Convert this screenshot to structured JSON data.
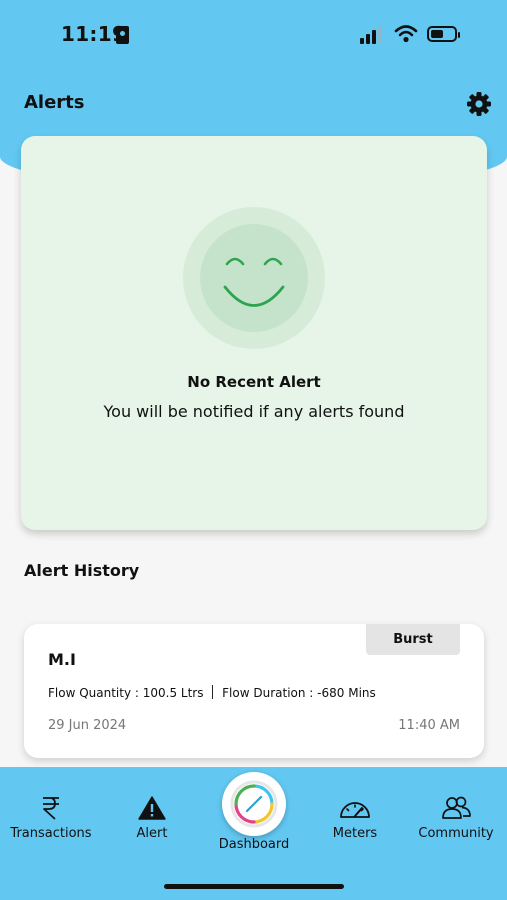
{
  "status_bar": {
    "time": "11:19"
  },
  "header": {
    "title": "Alerts"
  },
  "empty_state": {
    "title": "No Recent Alert",
    "subtitle": "You will be notified if any alerts found"
  },
  "history": {
    "heading": "Alert History",
    "items": [
      {
        "badge": "Burst",
        "title": "M.I",
        "flow_quantity_label": "Flow Quantity :",
        "flow_quantity_value": "100.5 Ltrs",
        "flow_duration_label": "Flow Duration :",
        "flow_duration_value": "-680 Mins",
        "date": "29 Jun 2024",
        "time": "11:40 AM"
      }
    ]
  },
  "bottom_nav": {
    "items": [
      {
        "label": "Transactions",
        "icon": "rupee-icon"
      },
      {
        "label": "Alert",
        "icon": "warning-icon"
      },
      {
        "label": "Dashboard",
        "icon": "dashboard-icon"
      },
      {
        "label": "Meters",
        "icon": "gauge-icon"
      },
      {
        "label": "Community",
        "icon": "community-icon"
      }
    ]
  },
  "colors": {
    "header_bg": "#62c8f2",
    "empty_card_bg": "#e6f5e8",
    "smile_green": "#2ea44f",
    "badge_bg": "#e4e4e4"
  }
}
